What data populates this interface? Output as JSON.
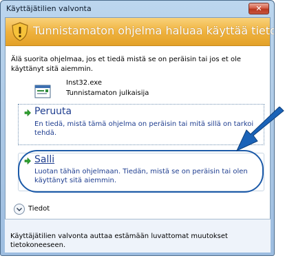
{
  "window": {
    "title": "Käyttäjätilien valvonta",
    "close_label": "✕"
  },
  "banner": {
    "text": "Tunnistamaton ohjelma haluaa käyttää tietokonetta",
    "icon": "shield-warning-icon"
  },
  "description": "Älä suorita ohjelmaa, jos et tiedä mistä se on peräisin tai jos et ole käyttänyt sitä aiemmin.",
  "program": {
    "name": "Inst32.exe",
    "publisher": "Tunnistamaton julkaisija",
    "icon": "installer-icon"
  },
  "options": {
    "cancel": {
      "title": "Peruuta",
      "desc_line1": "En tiedä, mistä tämä ohjelma on peräisin tai mitä sillä on tarkoi",
      "desc_line2": "tehdä."
    },
    "allow": {
      "title": "Salli",
      "desc": "Luotan tähän ohjelmaan. Tiedän, mistä se on peräisin tai olen käyttänyt sitä aiemmin."
    }
  },
  "details": {
    "label": "Tiedot"
  },
  "footer": {
    "text": "Käyttäjätilien valvonta auttaa estämään luvattomat muutokset tietokoneeseen."
  },
  "colors": {
    "banner": "#efb23e",
    "link_blue": "#1e3d8f",
    "annotation_blue": "#1c5aa8",
    "arrow_green": "#2fa12f"
  }
}
